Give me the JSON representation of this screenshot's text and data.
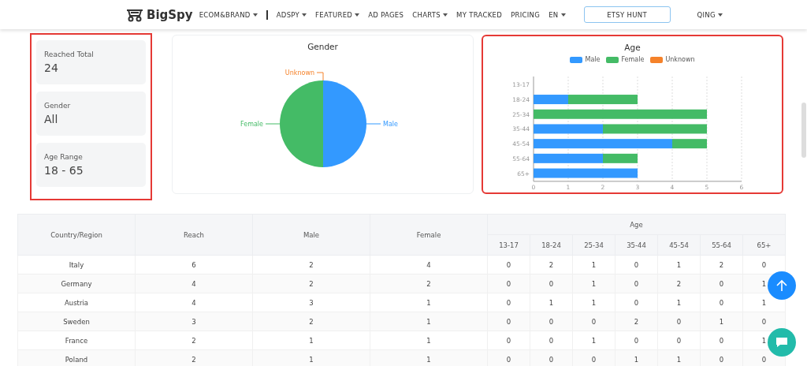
{
  "nav": {
    "brand": "BigSpy",
    "items": [
      {
        "label": "ECOM&BRAND",
        "dropdown": true,
        "divider_after": true
      },
      {
        "label": "ADSPY",
        "dropdown": true,
        "divider_after": false
      },
      {
        "label": "FEATURED",
        "dropdown": true,
        "divider_after": false
      },
      {
        "label": "AD PAGES",
        "dropdown": false,
        "divider_after": false
      },
      {
        "label": "CHARTS",
        "dropdown": true,
        "divider_after": false
      },
      {
        "label": "MY TRACKED",
        "dropdown": false,
        "divider_after": false
      },
      {
        "label": "PRICING",
        "dropdown": false,
        "divider_after": false
      },
      {
        "label": "EN",
        "dropdown": true,
        "divider_after": false
      }
    ],
    "button": "ETSY HUNT",
    "user": {
      "label": "QING",
      "dropdown": true
    }
  },
  "stats": {
    "highlighted": true,
    "cards": [
      {
        "label": "Reached Total",
        "value": "24"
      },
      {
        "label": "Gender",
        "value": "All"
      },
      {
        "label": "Age Range",
        "value": "18 - 65"
      }
    ]
  },
  "gender_card": {
    "highlighted": false,
    "chart_data": {
      "type": "pie",
      "title": "Gender",
      "categories": [
        "Male",
        "Female",
        "Unknown"
      ],
      "values": [
        50,
        50,
        0
      ]
    }
  },
  "age_card": {
    "highlighted": true,
    "chart_data": {
      "type": "bar",
      "title": "Age",
      "orientation": "horizontal",
      "stacked": true,
      "categories": [
        "13-17",
        "18-24",
        "25-34",
        "35-44",
        "45-54",
        "55-64",
        "65+"
      ],
      "series": [
        {
          "name": "Male",
          "color": "#3399ff",
          "values": [
            0,
            1,
            0,
            2,
            4,
            2,
            3
          ]
        },
        {
          "name": "Female",
          "color": "#44bb66",
          "values": [
            0,
            2,
            5,
            3,
            1,
            1,
            0
          ]
        },
        {
          "name": "Unknown",
          "color": "#f5822a",
          "values": [
            0,
            0,
            0,
            0,
            0,
            0,
            0
          ]
        }
      ],
      "xlim": [
        0,
        6
      ],
      "xticks": [
        0,
        1,
        2,
        3,
        4,
        5,
        6
      ],
      "grid": true,
      "legend": true
    }
  },
  "table": {
    "header_rows": [
      [
        {
          "text": "Country/Region",
          "rowspan": 2
        },
        {
          "text": "Reach",
          "rowspan": 2
        },
        {
          "text": "Male",
          "rowspan": 2
        },
        {
          "text": "Female",
          "rowspan": 2
        },
        {
          "text": "Age",
          "colspan": 7
        }
      ],
      [
        {
          "text": "13-17"
        },
        {
          "text": "18-24"
        },
        {
          "text": "25-34"
        },
        {
          "text": "35-44"
        },
        {
          "text": "45-54"
        },
        {
          "text": "55-64"
        },
        {
          "text": "65+"
        }
      ]
    ],
    "rows": [
      [
        "Italy",
        "6",
        "2",
        "4",
        "0",
        "2",
        "1",
        "0",
        "1",
        "2",
        "0"
      ],
      [
        "Germany",
        "4",
        "2",
        "2",
        "0",
        "0",
        "1",
        "0",
        "2",
        "0",
        "1"
      ],
      [
        "Austria",
        "4",
        "3",
        "1",
        "0",
        "1",
        "1",
        "0",
        "1",
        "0",
        "1"
      ],
      [
        "Sweden",
        "3",
        "2",
        "1",
        "0",
        "0",
        "0",
        "2",
        "0",
        "1",
        "0"
      ],
      [
        "France",
        "2",
        "1",
        "1",
        "0",
        "0",
        "1",
        "0",
        "0",
        "0",
        "1"
      ],
      [
        "Poland",
        "2",
        "1",
        "1",
        "0",
        "0",
        "0",
        "1",
        "1",
        "0",
        "0"
      ]
    ]
  }
}
